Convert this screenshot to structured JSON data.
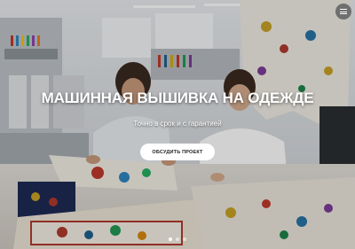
{
  "hero": {
    "title": "МАШИННАЯ ВЫШИВКА НА ОДЕЖДЕ",
    "subtitle": "Точно в срок и с гарантией",
    "cta_label": "ОБСУДИТЬ ПРОЕКТ"
  },
  "slider": {
    "slide_count": 3,
    "active_slide": 1
  },
  "menu": {
    "icon": "hamburger-icon"
  },
  "colors": {
    "overlay_text": "#ffffff",
    "button_bg": "#ffffff",
    "menu_button_bg": "#6f6f6f"
  }
}
